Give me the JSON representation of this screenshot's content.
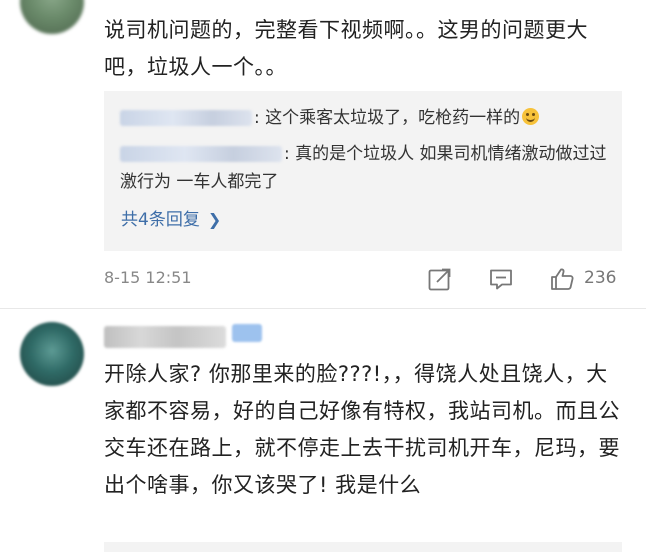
{
  "comment1": {
    "text": "说司机问题的，完整看下视频啊。。这男的问题更大吧，垃圾人一个。。",
    "replies": [
      {
        "text": ": 这个乘客太垃圾了，吃枪药一样的"
      },
      {
        "text": ": 真的是个垃圾人 如果司机情绪激动做过过激行为 一车人都完了"
      }
    ],
    "more_replies": "共4条回复",
    "time": "8-15 12:51",
    "like_count": "236"
  },
  "comment2": {
    "text": "开除人家? 你那里来的脸???!，，得饶人处且饶人，大家都不容易，好的自己好像有特权，我站司机。而且公交车还在路上，就不停走上去干扰司机开车，尼玛，要出个啥事，你又该哭了! 我是什么"
  },
  "icons": {
    "forward": "forward-icon",
    "comment": "comment-icon",
    "like": "like-icon",
    "chevron": "chevron-right-icon",
    "emoji": "smile-emoji-icon"
  },
  "colors": {
    "link": "#3e6ea8",
    "reply_bg": "#f3f3f3",
    "meta_text": "#888888"
  }
}
